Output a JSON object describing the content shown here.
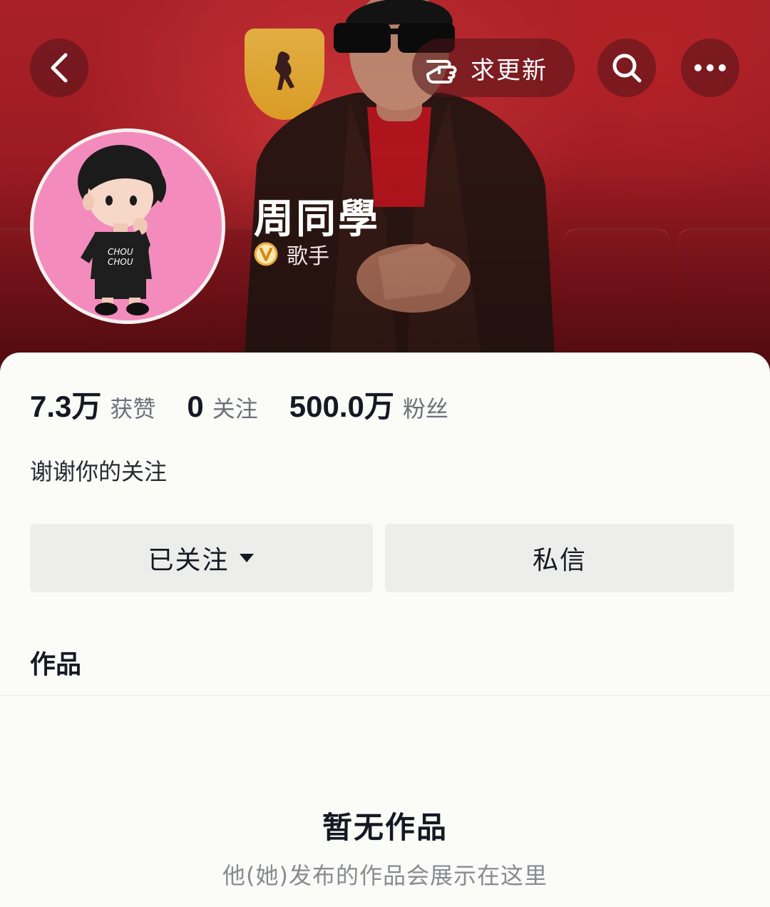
{
  "header": {
    "update_label": "求更新",
    "profile_name": "周同學",
    "verified_role": "歌手"
  },
  "stats": [
    {
      "value": "7.3万",
      "label": "获赞"
    },
    {
      "value": "0",
      "label": "关注"
    },
    {
      "value": "500.0万",
      "label": "粉丝"
    }
  ],
  "bio": "谢谢你的关注",
  "actions": {
    "follow_label": "已关注",
    "message_label": "私信"
  },
  "tabs": {
    "works_label": "作品"
  },
  "empty_state": {
    "title": "暂无作品",
    "subtitle": "他(她)发布的作品会展示在这里"
  },
  "colors": {
    "banner_red": "#9a1a22",
    "avatar_pink": "#f38cbc",
    "verified_gold": "#e9a93a",
    "button_bg": "#ededeb"
  },
  "icons": [
    "back-icon",
    "hand-pointer-icon",
    "search-icon",
    "more-icon",
    "verified-v-icon",
    "caret-down-icon"
  ]
}
